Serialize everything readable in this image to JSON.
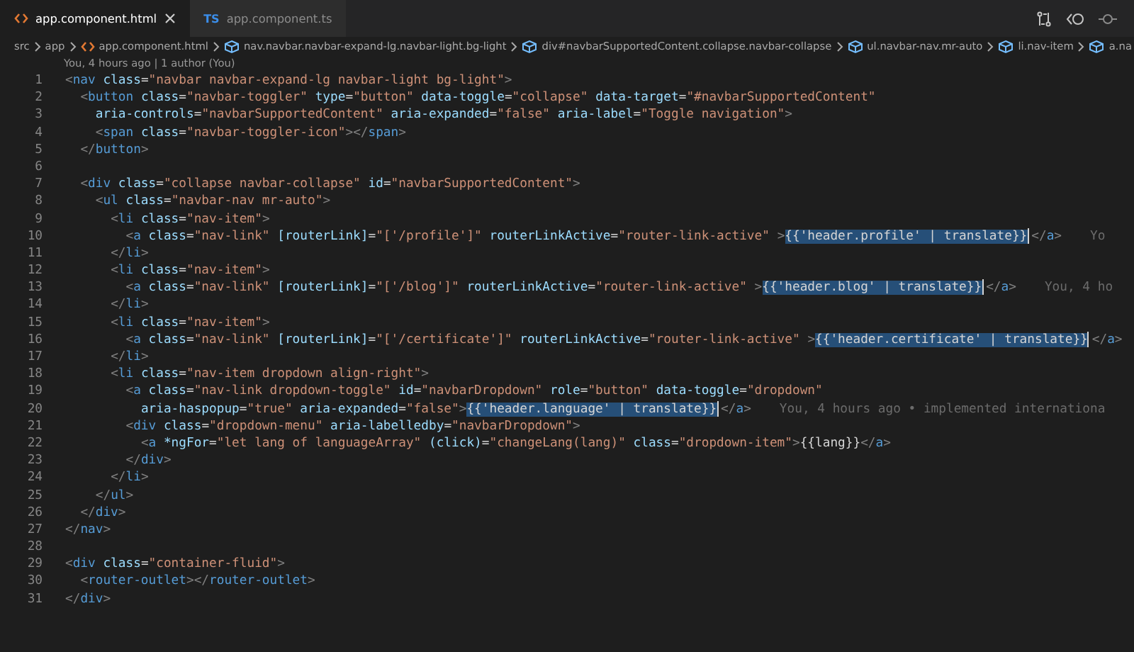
{
  "tabs": [
    {
      "label": "app.component.html",
      "kind": "html",
      "selected": true
    },
    {
      "label": "app.component.ts",
      "kind": "ts",
      "badge": "TS",
      "selected": false
    }
  ],
  "breadcrumb": [
    {
      "label": "src",
      "kind": "folder"
    },
    {
      "label": "app",
      "kind": "folder"
    },
    {
      "label": "app.component.html",
      "kind": "html"
    },
    {
      "label": "nav.navbar.navbar-expand-lg.navbar-light.bg-light",
      "kind": "element"
    },
    {
      "label": "div#navbarSupportedContent.collapse.navbar-collapse",
      "kind": "element"
    },
    {
      "label": "ul.navbar-nav.mr-auto",
      "kind": "element"
    },
    {
      "label": "li.nav-item",
      "kind": "element"
    },
    {
      "label": "a.na",
      "kind": "element"
    }
  ],
  "codelens": "You, 4 hours ago | 1 author (You)",
  "lines": [
    {
      "number": "1",
      "code": "<nav class=\"navbar navbar-expand-lg navbar-light bg-light\">"
    },
    {
      "number": "2",
      "code": "  <button class=\"navbar-toggler\" type=\"button\" data-toggle=\"collapse\" data-target=\"#navbarSupportedContent\""
    },
    {
      "number": "3",
      "code": "    aria-controls=\"navbarSupportedContent\" aria-expanded=\"false\" aria-label=\"Toggle navigation\">"
    },
    {
      "number": "4",
      "code": "    <span class=\"navbar-toggler-icon\"></span>"
    },
    {
      "number": "5",
      "code": "  </button>"
    },
    {
      "number": "6"
    },
    {
      "number": "7",
      "code": "  <div class=\"collapse navbar-collapse\" id=\"navbarSupportedContent\">"
    },
    {
      "number": "8",
      "code": "    <ul class=\"navbar-nav mr-auto\">"
    },
    {
      "number": "9",
      "code": "      <li class=\"nav-item\">"
    },
    {
      "number": "10",
      "code": "        <a class=\"nav-link\" [routerLink]=\"['/profile']\" routerLinkActive=\"router-link-active\" >",
      "selection": "{{'header.profile' | translate}}",
      "rest": "</a>",
      "blame": "Yo"
    },
    {
      "number": "11",
      "code": "      </li>"
    },
    {
      "number": "12",
      "code": "      <li class=\"nav-item\">"
    },
    {
      "number": "13",
      "code": "        <a class=\"nav-link\" [routerLink]=\"['/blog']\" routerLinkActive=\"router-link-active\" >",
      "selection": "{{'header.blog' | translate}}",
      "rest": "</a>",
      "blame": "You, 4 ho"
    },
    {
      "number": "14",
      "code": "      </li>"
    },
    {
      "number": "15",
      "code": "      <li class=\"nav-item\">"
    },
    {
      "number": "16",
      "code": "        <a class=\"nav-link\" [routerLink]=\"['/certificate']\" routerLinkActive=\"router-link-active\" >",
      "selection": "{{'header.certificate' | translate}}",
      "rest": "</a>"
    },
    {
      "number": "17",
      "code": "      </li>"
    },
    {
      "number": "18",
      "code": "      <li class=\"nav-item dropdown align-right\">"
    },
    {
      "number": "19",
      "code": "        <a class=\"nav-link dropdown-toggle\" id=\"navbarDropdown\" role=\"button\" data-toggle=\"dropdown\""
    },
    {
      "number": "20",
      "code": "          aria-haspopup=\"true\" aria-expanded=\"false\">",
      "selection": "{{'header.language' | translate}}",
      "rest": "</a>",
      "blame": "You, 4 hours ago • implemented internationa"
    },
    {
      "number": "21",
      "code": "        <div class=\"dropdown-menu\" aria-labelledby=\"navbarDropdown\">"
    },
    {
      "number": "22",
      "code": "          <a *ngFor=\"let lang of languageArray\" (click)=\"changeLang(lang)\" class=\"dropdown-item\">{{lang}}</a>"
    },
    {
      "number": "23",
      "code": "        </div>"
    },
    {
      "number": "24",
      "code": "      </li>"
    },
    {
      "number": "25",
      "code": "    </ul>"
    },
    {
      "number": "26",
      "code": "  </div>"
    },
    {
      "number": "27",
      "code": "</nav>"
    },
    {
      "number": "28"
    },
    {
      "number": "29",
      "code": "<div class=\"container-fluid\">"
    },
    {
      "number": "30",
      "code": "  <router-outlet></router-outlet>"
    },
    {
      "number": "31",
      "code": "</div>"
    }
  ]
}
